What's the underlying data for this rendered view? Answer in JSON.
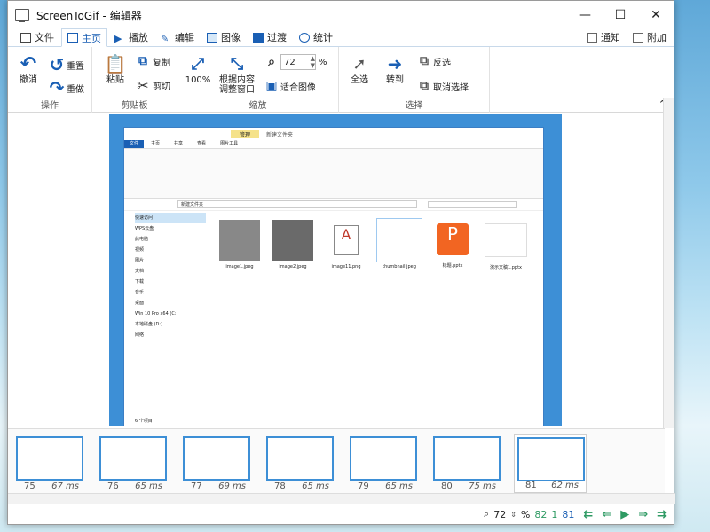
{
  "window": {
    "title": "ScreenToGif - 编辑器",
    "minimize": "—",
    "maximize": "☐",
    "close": "✕"
  },
  "tabs": [
    {
      "label": "文件"
    },
    {
      "label": "主页"
    },
    {
      "label": "播放"
    },
    {
      "label": "编辑"
    },
    {
      "label": "图像"
    },
    {
      "label": "过渡"
    },
    {
      "label": "统计"
    }
  ],
  "tabs_right": {
    "notify": "通知",
    "attach": "附加"
  },
  "ribbon": {
    "groups": {
      "actions": "操作",
      "clipboard": "剪贴板",
      "zoom": "缩放",
      "select": "选择"
    },
    "undo": "撤消",
    "redo": "重置",
    "redo2": "重做",
    "paste": "粘贴",
    "copy": "复制",
    "cut": "剪切",
    "zoom100": "100%",
    "fit_content": "根据内容\n调整窗口",
    "zoom_value": "72",
    "zoom_unit": "%",
    "fit_image": "适合图像",
    "select_all": "全选",
    "goto": "转到",
    "invert": "反选",
    "deselect": "取消选择"
  },
  "explorer": {
    "tab_file": "文件",
    "tab_home": "主页",
    "tab_share": "共享",
    "tab_view": "查看",
    "tab_manage": "管理",
    "tab_pictools": "图片工具",
    "title": "新建文件夹",
    "path": "新建文件夹",
    "sidebar": [
      "快速访问",
      "WPS云盘",
      "此电脑",
      "视频",
      "图片",
      "文档",
      "下载",
      "音乐",
      "桌面",
      "Win 10 Pro x64 (C:",
      "本地磁盘 (D:)",
      "网络"
    ],
    "files": [
      "image1.jpeg",
      "image2.jpeg",
      "image11.png",
      "thumbnail.jpeg",
      "标题.pptx",
      "演示文稿1.pptx"
    ],
    "status": "6 个项目"
  },
  "frames": [
    {
      "num": "75",
      "ms": "67 ms"
    },
    {
      "num": "76",
      "ms": "65 ms"
    },
    {
      "num": "77",
      "ms": "69 ms"
    },
    {
      "num": "78",
      "ms": "65 ms"
    },
    {
      "num": "79",
      "ms": "65 ms"
    },
    {
      "num": "80",
      "ms": "75 ms"
    },
    {
      "num": "81",
      "ms": "62 ms"
    }
  ],
  "statusbar": {
    "zoom": "72",
    "pct": "%",
    "sel": "82",
    "count": "1",
    "total": "81"
  }
}
